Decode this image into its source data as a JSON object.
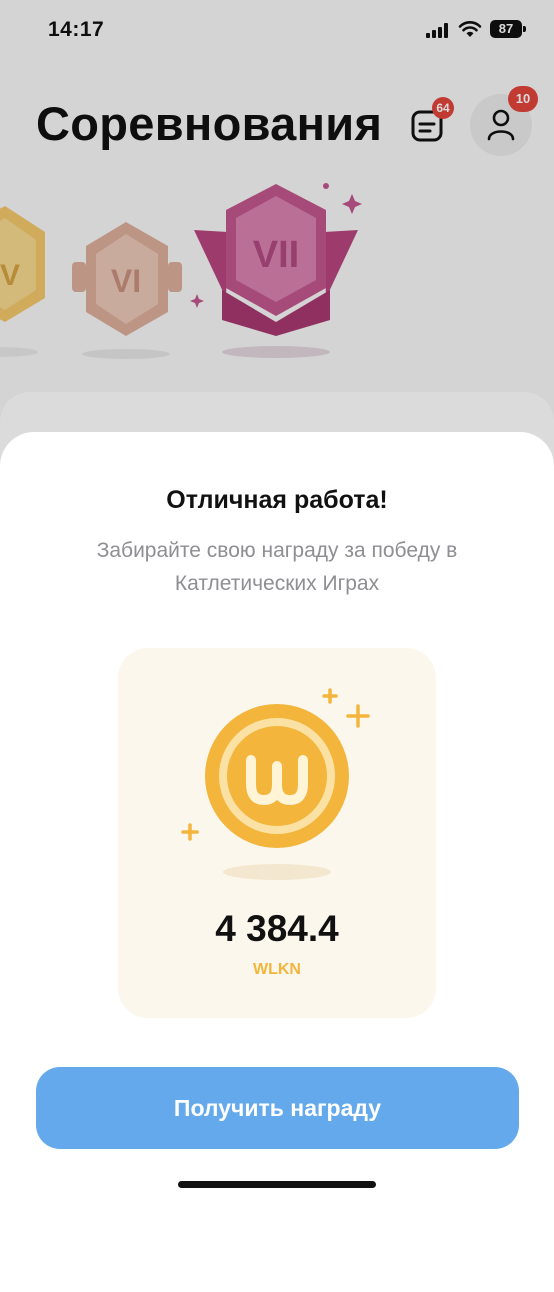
{
  "status_bar": {
    "time": "14:17",
    "battery": "87"
  },
  "header": {
    "title": "Соревнования",
    "chat_badge": "64",
    "profile_badge": "10"
  },
  "medals": [
    {
      "label": "V",
      "color": "#f1c86b"
    },
    {
      "label": "VI",
      "color": "#e6b8a6"
    },
    {
      "label": "VII",
      "color": "#c2578f"
    }
  ],
  "reward_sheet": {
    "title": "Отличная работа!",
    "subtitle": "Забирайте свою награду за победу в Катлетических Играх",
    "amount": "4 384.4",
    "currency": "WLKN",
    "claim_button": "Получить награду"
  },
  "colors": {
    "accent_button": "#64a9ec",
    "coin": "#f3b53c",
    "badge": "#e2453c",
    "card_bg": "#fcf7ec"
  }
}
